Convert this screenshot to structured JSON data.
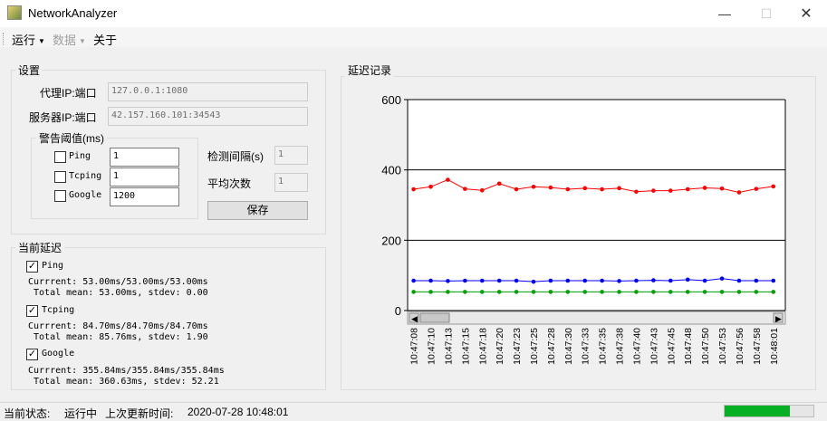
{
  "window": {
    "title": "NetworkAnalyzer"
  },
  "menu": [
    {
      "label": "运行",
      "has_dropdown": true,
      "enabled": true
    },
    {
      "label": "数据",
      "has_dropdown": true,
      "enabled": false
    },
    {
      "label": "关于",
      "has_dropdown": false,
      "enabled": true
    }
  ],
  "settings": {
    "group_title": "设置",
    "proxy_label": "代理IP:端口",
    "proxy_value": "127.0.0.1:1080",
    "server_label": "服务器IP:端口",
    "server_value": "42.157.160.101:34543",
    "threshold": {
      "title": "警告阈值(ms)",
      "items": [
        {
          "label": "Ping",
          "value": "1",
          "checked": false
        },
        {
          "label": "Tcping",
          "value": "1",
          "checked": false
        },
        {
          "label": "Google",
          "value": "1200",
          "checked": false
        }
      ]
    },
    "interval_label": "检测间隔(s)",
    "interval_value": "1",
    "avg_label": "平均次数",
    "avg_value": "1",
    "save_label": "保存"
  },
  "current": {
    "group_title": "当前延迟",
    "items": [
      {
        "label": "Ping",
        "checked": true,
        "line1": "Currrent: 53.00ms/53.00ms/53.00ms",
        "line2": " Total mean: 53.00ms, stdev: 0.00"
      },
      {
        "label": "Tcping",
        "checked": true,
        "line1": "Currrent: 84.70ms/84.70ms/84.70ms",
        "line2": " Total mean: 85.76ms, stdev: 1.90"
      },
      {
        "label": "Google",
        "checked": true,
        "line1": "Currrent: 355.84ms/355.84ms/355.84ms",
        "line2": " Total mean: 360.63ms, stdev: 52.21"
      }
    ]
  },
  "chart_panel": {
    "group_title": "延迟记录"
  },
  "chart_data": {
    "type": "line",
    "title": "",
    "xlabel": "",
    "ylabel": "",
    "ylim": [
      0,
      600
    ],
    "yticks": [
      0,
      200,
      400,
      600
    ],
    "grid": "horizontal",
    "x": [
      "10:47:08",
      "10:47:10",
      "10:47:13",
      "10:47:15",
      "10:47:18",
      "10:47:20",
      "10:47:23",
      "10:47:25",
      "10:47:28",
      "10:47:30",
      "10:47:33",
      "10:47:35",
      "10:47:38",
      "10:47:40",
      "10:47:43",
      "10:47:45",
      "10:47:48",
      "10:47:50",
      "10:47:53",
      "10:47:56",
      "10:47:58",
      "10:48:01"
    ],
    "series": [
      {
        "color": "#ff0000",
        "values": [
          345,
          352,
          372,
          346,
          342,
          361,
          345,
          352,
          350,
          345,
          348,
          345,
          348,
          338,
          341,
          341,
          345,
          349,
          347,
          336,
          346,
          353
        ]
      },
      {
        "color": "#0000ff",
        "values": [
          85,
          85,
          84,
          85,
          85,
          85,
          85,
          82,
          85,
          85,
          85,
          85,
          84,
          85,
          86,
          85,
          88,
          85,
          91,
          85,
          85,
          85
        ]
      },
      {
        "color": "#00a000",
        "values": [
          53,
          53,
          53,
          53,
          53,
          53,
          53,
          53,
          53,
          53,
          53,
          53,
          53,
          53,
          53,
          53,
          53,
          53,
          53,
          53,
          53,
          53
        ]
      }
    ]
  },
  "status": {
    "state_label": "当前状态:",
    "state_value": "运行中",
    "update_label": "上次更新时间:",
    "update_value": "2020-07-28 10:48:01",
    "progress": 0.73,
    "progress_color": "#06b025"
  }
}
